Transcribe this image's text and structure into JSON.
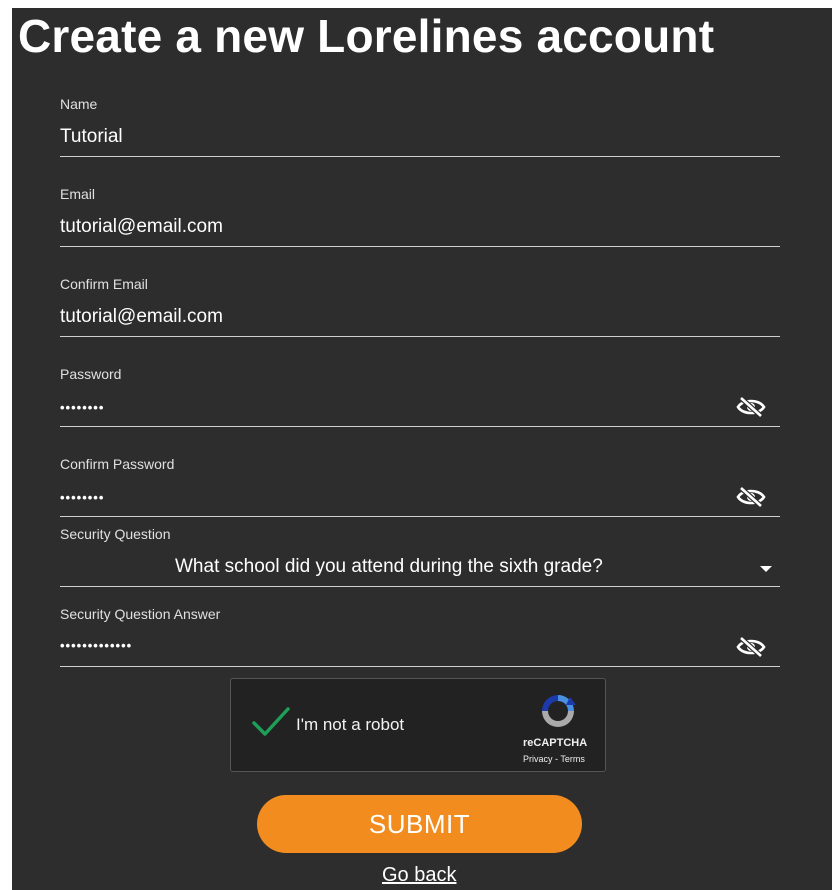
{
  "page": {
    "title": "Create a new Lorelines account"
  },
  "fields": {
    "name": {
      "label": "Name",
      "value": "Tutorial"
    },
    "email": {
      "label": "Email",
      "value": "tutorial@email.com"
    },
    "confirm_email": {
      "label": "Confirm Email",
      "value": "tutorial@email.com"
    },
    "password": {
      "label": "Password",
      "value": "••••••••"
    },
    "confirm_password": {
      "label": "Confirm Password",
      "value": "••••••••"
    },
    "security_question": {
      "label": "Security Question",
      "value": "What school did you attend during the sixth grade?"
    },
    "security_answer": {
      "label": "Security Question Answer",
      "value": "•••••••••••••"
    }
  },
  "captcha": {
    "text": "I'm not a robot",
    "brand": "reCAPTCHA",
    "links": "Privacy - Terms",
    "checked": true
  },
  "actions": {
    "submit_label": "SUBMIT",
    "go_back_label": "Go back"
  },
  "colors": {
    "background": "#2d2d2d",
    "accent": "#f28c1f",
    "check": "#1e9e57"
  },
  "icons": {
    "visibility": "eye-slash-icon",
    "dropdown": "caret-down-icon"
  }
}
